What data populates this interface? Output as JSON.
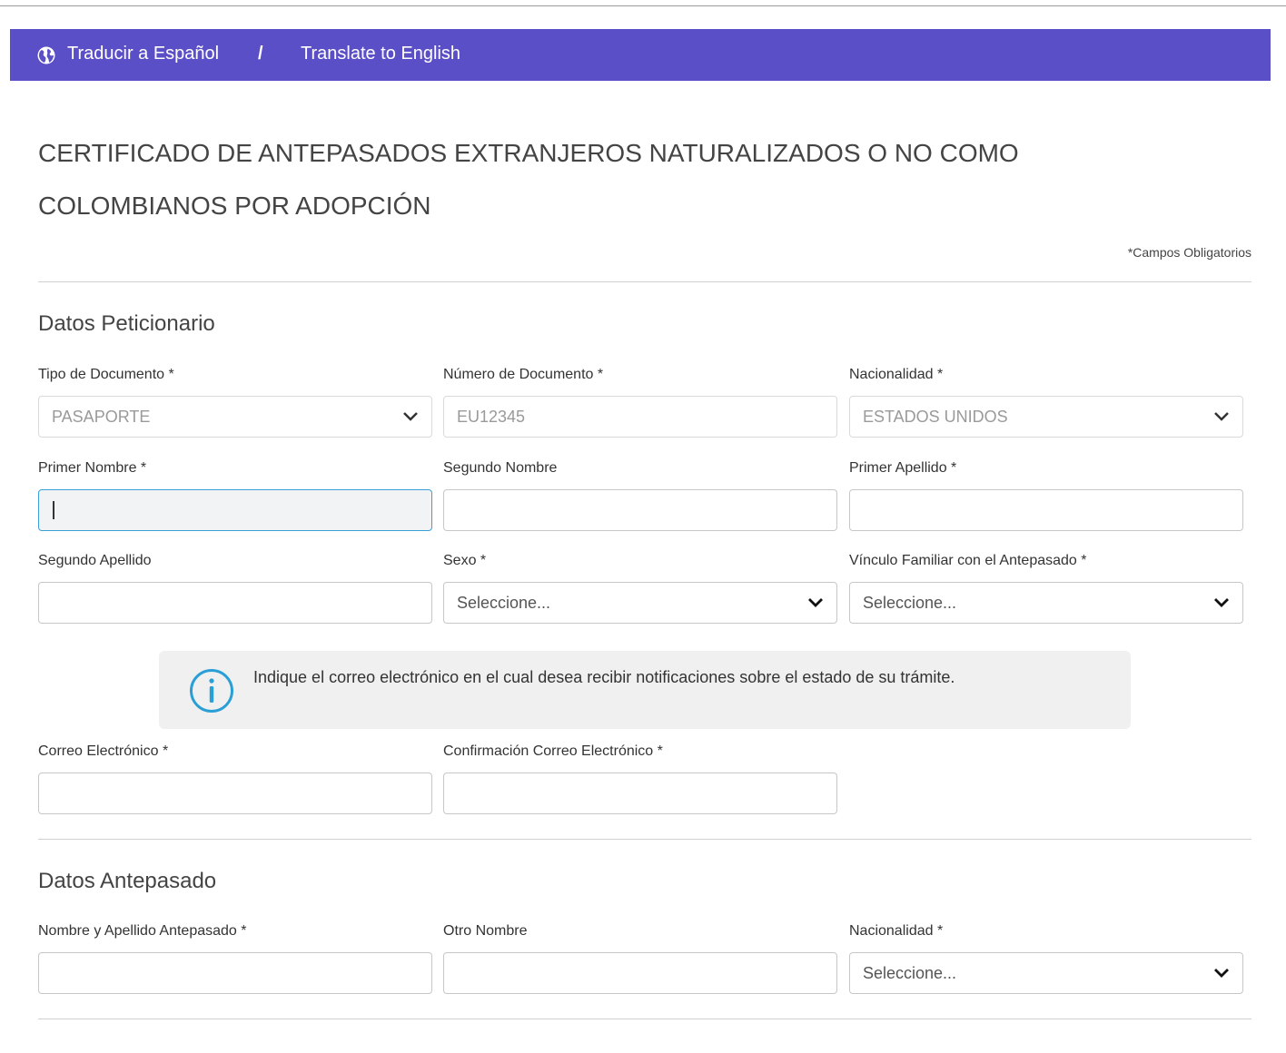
{
  "lang_bar": {
    "spanish": "Traducir a Español",
    "separator": "/",
    "english": "Translate to English"
  },
  "title_line1": "CERTIFICADO DE ANTEPASADOS EXTRANJEROS NATURALIZADOS O NO COMO",
  "title_line2": "COLOMBIANOS POR ADOPCIÓN",
  "required_note": "*Campos Obligatorios",
  "petitioner": {
    "title": "Datos Peticionario",
    "doc_type_label": "Tipo de Documento *",
    "doc_type_value": "PASAPORTE",
    "doc_number_label": "Número de Documento *",
    "doc_number_value": "EU12345",
    "nationality_label": "Nacionalidad *",
    "nationality_value": "ESTADOS UNIDOS",
    "first_name_label": "Primer Nombre *",
    "second_name_label": "Segundo Nombre",
    "first_surname_label": "Primer Apellido *",
    "second_surname_label": "Segundo Apellido",
    "sex_label": "Sexo *",
    "sex_value": "Seleccione...",
    "relation_label": "Vínculo Familiar con el Antepasado *",
    "relation_value": "Seleccione...",
    "info_text": "Indique el correo electrónico en el cual desea recibir notificaciones sobre el estado de su trámite.",
    "email_label": "Correo Electrónico *",
    "email_confirm_label": "Confirmación Correo Electrónico *"
  },
  "ancestor": {
    "title": "Datos Antepasado",
    "name_label": "Nombre y Apellido Antepasado *",
    "other_name_label": "Otro Nombre",
    "nationality_label": "Nacionalidad *",
    "nationality_value": "Seleccione..."
  },
  "colors": {
    "lang_bar_bg": "#5b4fc7",
    "focus_border": "#3aa0d8",
    "info_icon": "#2a9fd6"
  }
}
